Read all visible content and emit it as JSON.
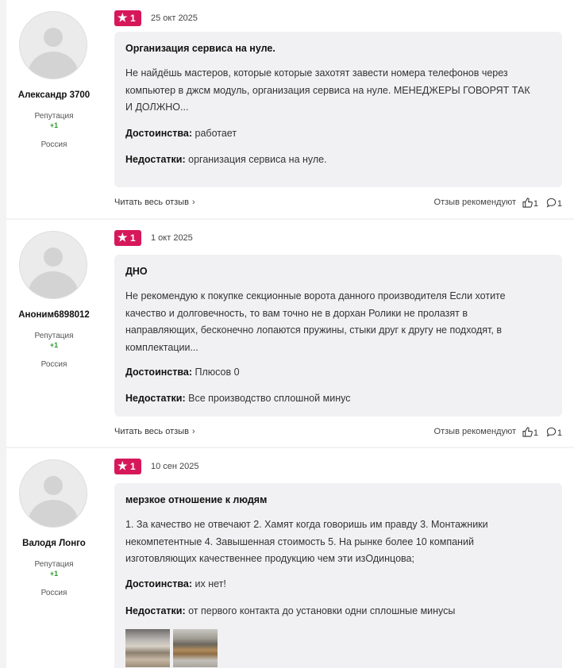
{
  "reviews": [
    {
      "author": {
        "name": "Александр 3700",
        "reputation_label": "Репутация",
        "reputation_value": "+1",
        "country": "Россия",
        "avatar_icon": "default-avatar-icon"
      },
      "rating": "1",
      "date": "25 окт 2025",
      "title": "Организация сервиса на нуле.",
      "text": "Не найдёшь мастеров, которые которые захотят завести номера телефонов через компьютер в джсм модуль, организация сервиса на нуле. МЕНЕДЖЕРЫ ГОВОРЯТ ТАК И ДОЛЖНО...",
      "pros_label": "Достоинства:",
      "pros": "работает",
      "cons_label": "Недостатки:",
      "cons": "организация сервиса на нуле.",
      "read_more": "Читать весь отзыв",
      "recommend_label": "Отзыв рекомендуют",
      "likes": "1",
      "comments": "1"
    },
    {
      "author": {
        "name": "Аноним6898012",
        "reputation_label": "Репутация",
        "reputation_value": "+1",
        "country": "Россия",
        "avatar_icon": "default-avatar-icon"
      },
      "rating": "1",
      "date": "1 окт 2025",
      "title": "ДНО",
      "text": "Не рекомендую к покупке секционные ворота данного производителя Если хотите качество и долговечность, то вам точно не в дорхан Ролики не пролазят в направляющих, бесконечно лопаются пружины, стыки друг к другу не подходят, в комплектации...",
      "pros_label": "Достоинства:",
      "pros": "Плюсов 0",
      "cons_label": "Недостатки:",
      "cons": "Все производство сплошной минус",
      "read_more": "Читать весь отзыв",
      "recommend_label": "Отзыв рекомендуют",
      "likes": "1",
      "comments": "1"
    },
    {
      "author": {
        "name": "Валодя Лонго",
        "reputation_label": "Репутация",
        "reputation_value": "+1",
        "country": "Россия",
        "avatar_icon": "default-avatar-icon"
      },
      "rating": "1",
      "date": "10 сен 2025",
      "title": "мерзкое отношение к людям",
      "text": "1. За качество не отвечают 2. Хамят когда говоришь им правду 3. Монтажники некомпетентные 4. Завышенная стоимость 5. На рынке более 10 компаний изготовляющих качественнее продукцию чем эти изОдинцова;",
      "pros_label": "Достоинства:",
      "pros": "их нет!",
      "cons_label": "Недостатки:",
      "cons": "от первого контакта до установки одни сплошные минусы"
    }
  ],
  "colors": {
    "rating_badge": "#d6185a",
    "reputation": "#2a9d2a",
    "review_box": "#f1f1f3"
  },
  "icons": {
    "rating": "star-icon",
    "more": "chevron-right-icon",
    "like": "thumbs-up-icon",
    "comment": "comment-icon"
  }
}
